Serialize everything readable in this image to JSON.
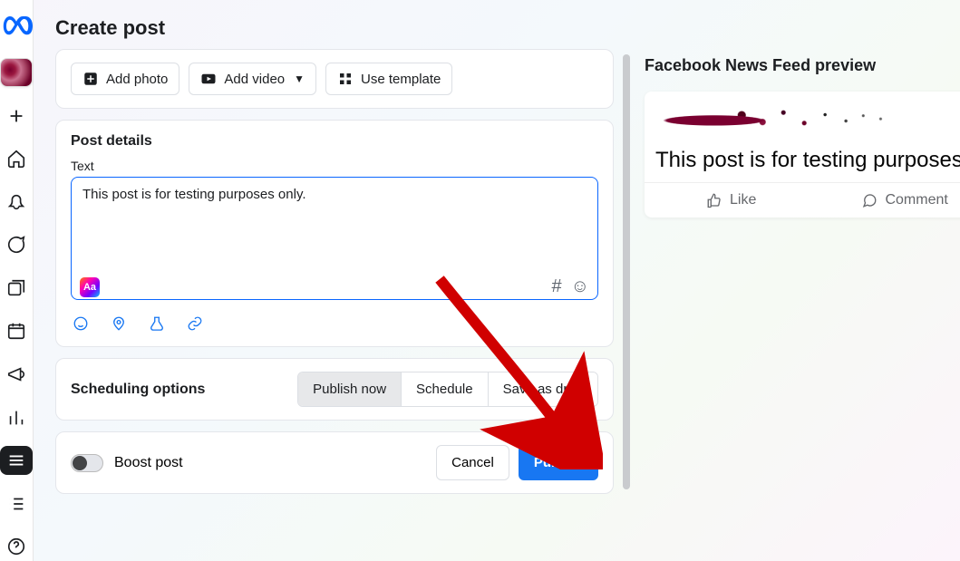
{
  "page_title": "Create post",
  "media": {
    "add_photo": "Add photo",
    "add_video": "Add video",
    "use_template": "Use template"
  },
  "details": {
    "title": "Post details",
    "text_label": "Text",
    "text_value": "This post is for testing purposes only.",
    "text_styles_label": "Aa"
  },
  "scheduling": {
    "title": "Scheduling options",
    "options": [
      "Publish now",
      "Schedule",
      "Save as draft"
    ],
    "selected_index": 0
  },
  "footer": {
    "boost_label": "Boost post",
    "boost_on": false,
    "cancel": "Cancel",
    "publish": "Publish"
  },
  "preview": {
    "title": "Facebook News Feed preview",
    "post_text": "This post is for testing purposes o",
    "like": "Like",
    "comment": "Comment"
  },
  "rail": {
    "items": [
      "create",
      "home",
      "notifications",
      "inbox",
      "content",
      "planner",
      "ads",
      "insights",
      "menu",
      "list",
      "help"
    ]
  }
}
